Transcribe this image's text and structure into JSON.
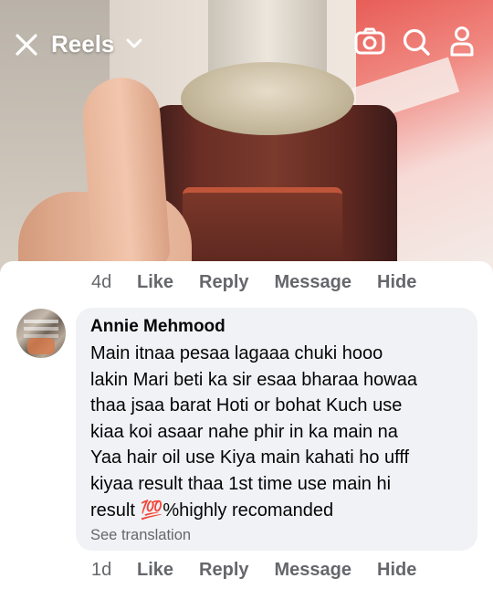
{
  "header": {
    "title": "Reels",
    "icons": [
      "close-icon",
      "chevron-down-icon",
      "camera-icon",
      "search-icon",
      "profile-icon"
    ]
  },
  "colors": {
    "text_primary": "#050505",
    "text_secondary": "#65676b",
    "bubble": "#f0f2f5",
    "hundred_emoji": "#e0243a"
  },
  "comments": [
    {
      "time": "4d",
      "actions": [
        "Like",
        "Reply",
        "Message",
        "Hide"
      ]
    },
    {
      "author": "Annie Mehmood",
      "text_lines": [
        "Main itnaa pesaa lagaaa chuki hooo",
        "lakin Mari beti ka sir esaa bharaa howaa",
        "thaa jsaa barat Hoti or bohat Kuch use",
        "kiaa koi asaar nahe phir in ka main na",
        "Yaa hair oil use Kiya main kahati ho ufff",
        "kiyaa result thaa 1st time use main hi"
      ],
      "text_last_prefix": "result ",
      "emoji": "💯",
      "text_last_suffix": "%highly recomanded",
      "translate_label": "See translation",
      "time": "1d",
      "actions": [
        "Like",
        "Reply",
        "Message",
        "Hide"
      ]
    }
  ]
}
